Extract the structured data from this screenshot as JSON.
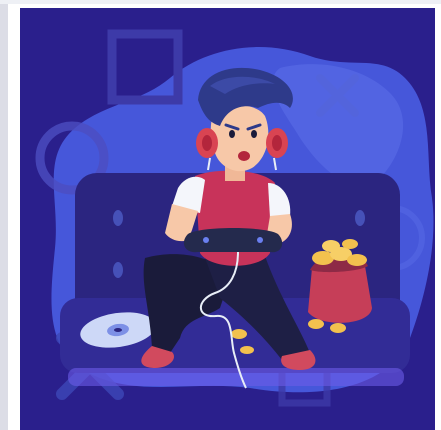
{
  "image": {
    "subject": "gamer-illustration",
    "colors": {
      "background": "#2a1f8c",
      "blob": "#4b62e8",
      "couch": "#2b2580",
      "shirt": "#c8335a",
      "hair": "#2e3a8a",
      "skin": "#f7c8a8",
      "headphones": "#d94452",
      "pants": "#1a1b3a",
      "shoes": "#d14a5e",
      "chips_bag": "#c63e58",
      "chips": "#f2c14e",
      "controller": "#242a4d",
      "cable": "#e8eef7"
    },
    "icons": [
      "square-symbol-icon",
      "circle-symbol-icon",
      "cross-symbol-icon",
      "game-disc-icon",
      "chips-bag-icon",
      "gamepad-controller-icon"
    ]
  }
}
